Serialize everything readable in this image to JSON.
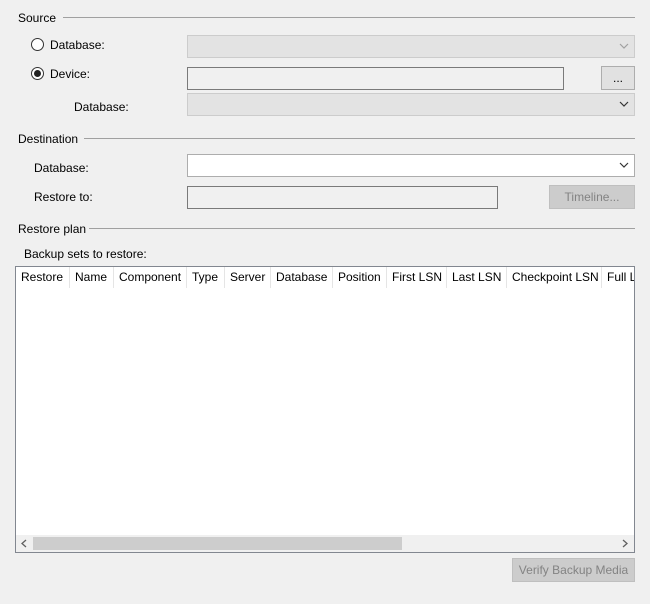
{
  "source": {
    "title": "Source",
    "database_option": {
      "label": "Database:",
      "selected": false,
      "value": ""
    },
    "device_option": {
      "label": "Device:",
      "selected": true,
      "path": ""
    },
    "browse_label": "...",
    "device_database": {
      "label": "Database:",
      "value": ""
    }
  },
  "destination": {
    "title": "Destination",
    "database": {
      "label": "Database:",
      "value": ""
    },
    "restore_to": {
      "label": "Restore to:",
      "value": ""
    },
    "timeline_label": "Timeline..."
  },
  "restore_plan": {
    "title": "Restore plan",
    "backup_sets_label": "Backup sets to restore:",
    "columns": [
      "Restore",
      "Name",
      "Component",
      "Type",
      "Server",
      "Database",
      "Position",
      "First LSN",
      "Last LSN",
      "Checkpoint LSN",
      "Full LSN"
    ],
    "rows": []
  },
  "verify_label": "Verify Backup Media",
  "icons": {
    "dropdown": "chevron-down-icon",
    "scroll_left": "chevron-left-icon",
    "scroll_right": "chevron-right-icon"
  },
  "colors": {
    "background": "#f0f0f0",
    "disabled_field": "#e3e3e3",
    "grid_background": "#ffffff",
    "disabled_button": "#cccccc"
  }
}
